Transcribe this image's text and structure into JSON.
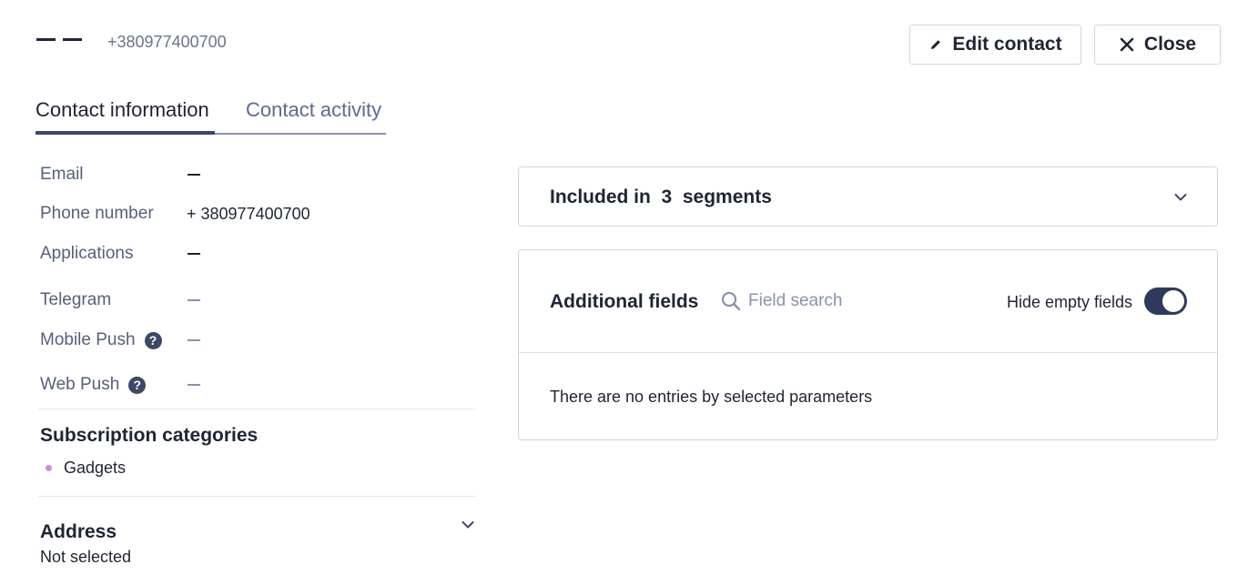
{
  "header": {
    "name_placeholder": "— —",
    "phone": "+380977400700",
    "edit_label": "Edit contact",
    "close_label": "Close"
  },
  "tabs": [
    {
      "label": "Contact information",
      "active": true
    },
    {
      "label": "Contact activity",
      "active": false
    }
  ],
  "fields": {
    "email": {
      "label": "Email",
      "value": "—"
    },
    "phone": {
      "label": "Phone number",
      "value": "+ 380977400700"
    },
    "applications": {
      "label": "Applications",
      "value": "—"
    },
    "telegram": {
      "label": "Telegram",
      "value": "—"
    },
    "mobile_push": {
      "label": "Mobile Push",
      "value": "—",
      "icon": "help-icon"
    },
    "web_push": {
      "label": "Web Push",
      "value": "—",
      "icon": "help-icon"
    }
  },
  "subscription": {
    "title": "Subscription categories",
    "items": [
      {
        "label": "Gadgets",
        "color": "#d48ad9"
      }
    ]
  },
  "address": {
    "title": "Address",
    "value": "Not selected"
  },
  "segments": {
    "prefix": "Included in",
    "count": "3",
    "suffix": "segments"
  },
  "additional_fields": {
    "title": "Additional fields",
    "search_placeholder": "Field search",
    "hide_empty_label": "Hide empty fields",
    "hide_empty_on": true,
    "empty_message": "There are no entries by selected parameters"
  },
  "colors": {
    "accent": "#3d4866",
    "toggle_on": "#2e3a5c",
    "category_dot": "#d48ad9"
  }
}
